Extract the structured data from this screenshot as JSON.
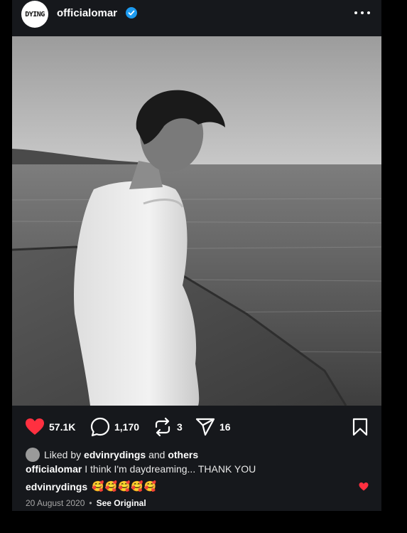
{
  "post": {
    "avatar_text": "DYING",
    "username": "officialomar",
    "icons": {
      "verified": "verified-badge-icon",
      "more": "more-options-icon"
    },
    "colors": {
      "heart": "#ff3040",
      "verified": "#1d9bf0",
      "background": "#16181c"
    },
    "actions": {
      "likes": "57.1K",
      "comments": "1,170",
      "reposts": "3",
      "shares": "16"
    },
    "liked_by": {
      "prefix": "Liked by",
      "user": "edvinrydings",
      "conjunction": "and",
      "others": "others"
    },
    "caption": {
      "user": "officialomar",
      "text": "I think I'm daydreaming... THANK YOU"
    },
    "top_comment": {
      "user": "edvinrydings",
      "text": "🥰🥰🥰🥰🥰"
    },
    "date": "20 August 2020",
    "separator": "•",
    "see_original": "See Original"
  }
}
